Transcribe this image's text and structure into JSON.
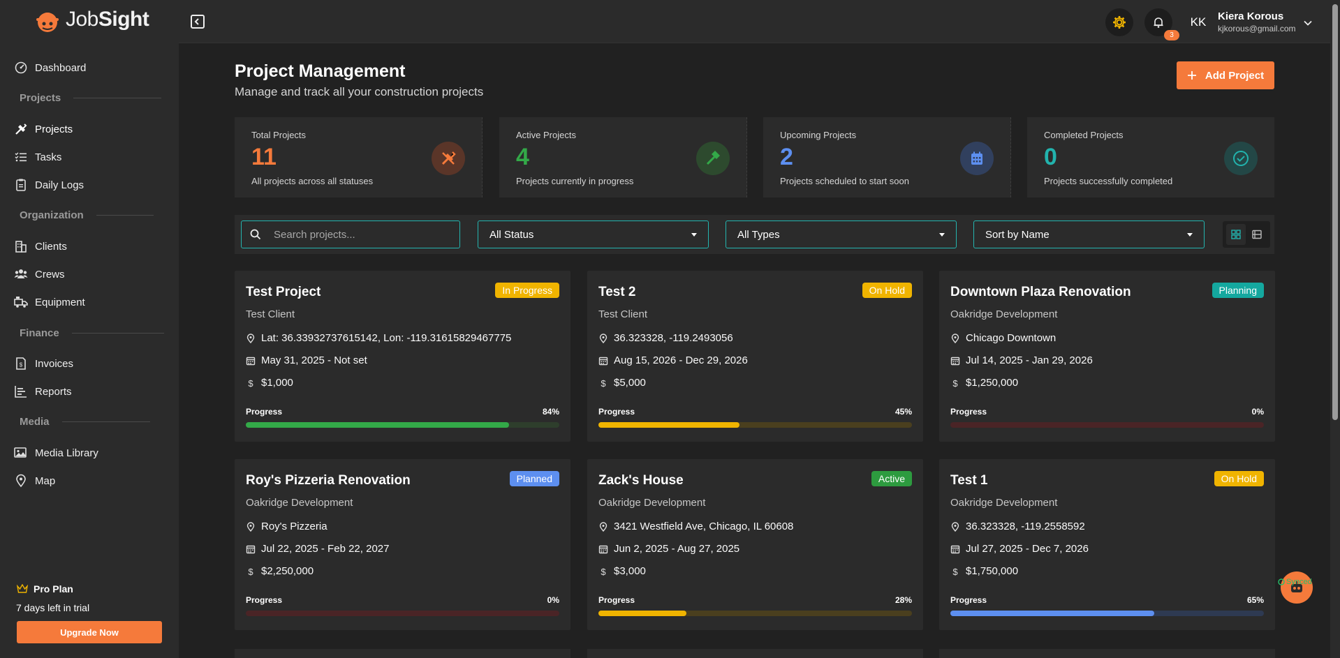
{
  "brand": {
    "name_part1": "Job",
    "name_part2": "Sight"
  },
  "sidebar": {
    "items": [
      {
        "label": "Dashboard",
        "icon": "dashboard-icon"
      },
      {
        "label": "Projects",
        "icon": "tools-icon"
      },
      {
        "label": "Tasks",
        "icon": "tasks-icon"
      },
      {
        "label": "Daily Logs",
        "icon": "clipboard-icon"
      },
      {
        "label": "Clients",
        "icon": "building-icon"
      },
      {
        "label": "Crews",
        "icon": "users-icon"
      },
      {
        "label": "Equipment",
        "icon": "truck-icon"
      },
      {
        "label": "Invoices",
        "icon": "invoice-icon"
      },
      {
        "label": "Reports",
        "icon": "chart-icon"
      },
      {
        "label": "Media Library",
        "icon": "image-icon"
      },
      {
        "label": "Map",
        "icon": "map-pin-icon"
      }
    ],
    "sections": [
      "Projects",
      "Organization",
      "Finance",
      "Media"
    ],
    "plan": {
      "title": "Pro Plan",
      "subtitle": "7 days left in trial",
      "button": "Upgrade Now"
    }
  },
  "topbar": {
    "notification_count": "3",
    "user": {
      "initials": "KK",
      "name": "Kiera Korous",
      "email": "kjkorous@gmail.com"
    }
  },
  "header": {
    "title": "Project Management",
    "subtitle": "Manage and track all your construction projects",
    "add_button": "Add Project"
  },
  "stats": [
    {
      "label": "Total Projects",
      "value": "11",
      "desc": "All projects across all statuses",
      "color": "#f57a3b",
      "icon": "tools-icon"
    },
    {
      "label": "Active Projects",
      "value": "4",
      "desc": "Projects currently in progress",
      "color": "#33a948",
      "icon": "hammer-icon"
    },
    {
      "label": "Upcoming Projects",
      "value": "2",
      "desc": "Projects scheduled to start soon",
      "color": "#5d8ff0",
      "icon": "calendar-icon"
    },
    {
      "label": "Completed Projects",
      "value": "0",
      "desc": "Projects successfully completed",
      "color": "#22b3ad",
      "icon": "check-circle-icon"
    }
  ],
  "filters": {
    "search_placeholder": "Search projects...",
    "status": "All Status",
    "type": "All Types",
    "sort": "Sort by Name"
  },
  "projects": [
    {
      "title": "Test Project",
      "badge": "In Progress",
      "badge_color": "#f0b400",
      "client": "Test Client",
      "location": "Lat: 36.33932737615142, Lon: -119.31615829467775",
      "dates": "May 31, 2025 - Not set",
      "budget": "$1,000",
      "progress_label": "Progress",
      "progress_text": "84%",
      "progress": 84,
      "bar_color": "#33a948",
      "track_color": "#2e3e2c"
    },
    {
      "title": "Test 2",
      "badge": "On Hold",
      "badge_color": "#f0b400",
      "client": "Test Client",
      "location": "36.323328, -119.2493056",
      "dates": "Aug 15, 2026 - Dec 29, 2026",
      "budget": "$5,000",
      "progress_label": "Progress",
      "progress_text": "45%",
      "progress": 45,
      "bar_color": "#f0b400",
      "track_color": "#4a3f1e"
    },
    {
      "title": "Downtown Plaza Renovation",
      "badge": "Planning",
      "badge_color": "#14a89f",
      "client": "Oakridge Development",
      "location": "Chicago Downtown",
      "dates": "Jul 14, 2025 - Jan 29, 2026",
      "budget": "$1,250,000",
      "progress_label": "Progress",
      "progress_text": "0%",
      "progress": 0,
      "bar_color": "#b53a3a",
      "track_color": "#4a2426"
    },
    {
      "title": "Roy's Pizzeria Renovation",
      "badge": "Planned",
      "badge_color": "#5d8ff0",
      "client": "Oakridge Development",
      "location": "Roy's Pizzeria",
      "dates": "Jul 22, 2025 - Feb 22, 2027",
      "budget": "$2,250,000",
      "progress_label": "Progress",
      "progress_text": "0%",
      "progress": 0,
      "bar_color": "#b53a3a",
      "track_color": "#4a2426"
    },
    {
      "title": "Zack's House",
      "badge": "Active",
      "badge_color": "#2d9b3f",
      "client": "Oakridge Development",
      "location": "3421 Westfield Ave, Chicago, IL 60608",
      "dates": "Jun 2, 2025 - Aug 27, 2025",
      "budget": "$3,000",
      "progress_label": "Progress",
      "progress_text": "28%",
      "progress": 28,
      "bar_color": "#f0b400",
      "track_color": "#4a3f1e"
    },
    {
      "title": "Test 1",
      "badge": "On Hold",
      "badge_color": "#f0b400",
      "client": "Oakridge Development",
      "location": "36.323328, -119.2558592",
      "dates": "Jul 27, 2025 - Dec 7, 2026",
      "budget": "$1,750,000",
      "progress_label": "Progress",
      "progress_text": "65%",
      "progress": 65,
      "bar_color": "#5d8ff0",
      "track_color": "#2e3a52"
    }
  ],
  "chat": {
    "status": "Synced"
  }
}
